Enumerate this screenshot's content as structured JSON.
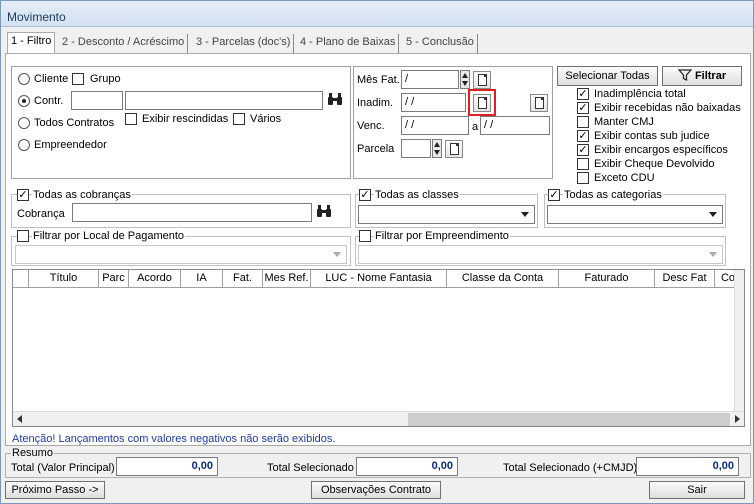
{
  "window": {
    "title": "Movimento"
  },
  "tabs": [
    "1 - Filtro",
    "2 - Desconto / Acréscimo",
    "3 - Parcelas (doc's)",
    "4 - Plano de Baixas",
    "5 - Conclusão"
  ],
  "entity": {
    "cliente": "Cliente",
    "grupo": "Grupo",
    "contr": "Contr.",
    "todos_contratos": "Todos Contratos",
    "empreendedor": "Empreendedor",
    "exibir_rescindidas": "Exibir rescindidas",
    "varios": "Vários",
    "selected": "contr"
  },
  "dates": {
    "mes_fat_label": "Mês Fat.",
    "mes_fat_value": "  /",
    "inadim_label": "Inadim.",
    "inadim_value": " / /",
    "venc_label": "Venc.",
    "venc_from": " / /",
    "venc_a": "a",
    "venc_to": " / /",
    "parcela_label": "Parcela"
  },
  "filters": {
    "select_all": "Selecionar Todas",
    "filtrar": "Filtrar",
    "options": [
      {
        "label": "Inadimplência total",
        "checked": true
      },
      {
        "label": "Exibir recebidas não baixadas",
        "checked": true
      },
      {
        "label": "Manter CMJ",
        "checked": false
      },
      {
        "label": "Exibir contas sub judice",
        "checked": true
      },
      {
        "label": "Exibir encargos específicos",
        "checked": true
      },
      {
        "label": "Exibir Cheque Devolvido",
        "checked": false
      },
      {
        "label": "Exceto CDU",
        "checked": false
      }
    ]
  },
  "cobranca": {
    "todas": "Todas as cobranças",
    "label": "Cobrança"
  },
  "classes": {
    "todas": "Todas as classes"
  },
  "categorias": {
    "todas": "Todas as categorias"
  },
  "local": {
    "label": "Filtrar por Local de Pagamento"
  },
  "empreendimento": {
    "label": "Filtrar por Empreendimento"
  },
  "grid": {
    "columns": [
      "Título",
      "Parc",
      "Acordo",
      "IA",
      "Fat.",
      "Mes Ref.",
      "LUC - Nome Fantasia",
      "Classe da Conta",
      "Faturado",
      "Desc Fat",
      "Co"
    ]
  },
  "warning": "Atenção! Lançamentos com valores negativos não serão exibidos.",
  "resumo": {
    "title": "Resumo",
    "total_label": "Total (Valor Principal)",
    "total_value": "0,00",
    "selecionado_label": "Total Selecionado",
    "selecionado_value": "0,00",
    "cmjd_label": "Total Selecionado (+CMJD)",
    "cmjd_value": "0,00"
  },
  "footer": {
    "proximo": "Próximo Passo ->",
    "observacoes": "Observações Contrato",
    "sair": "Sair"
  }
}
